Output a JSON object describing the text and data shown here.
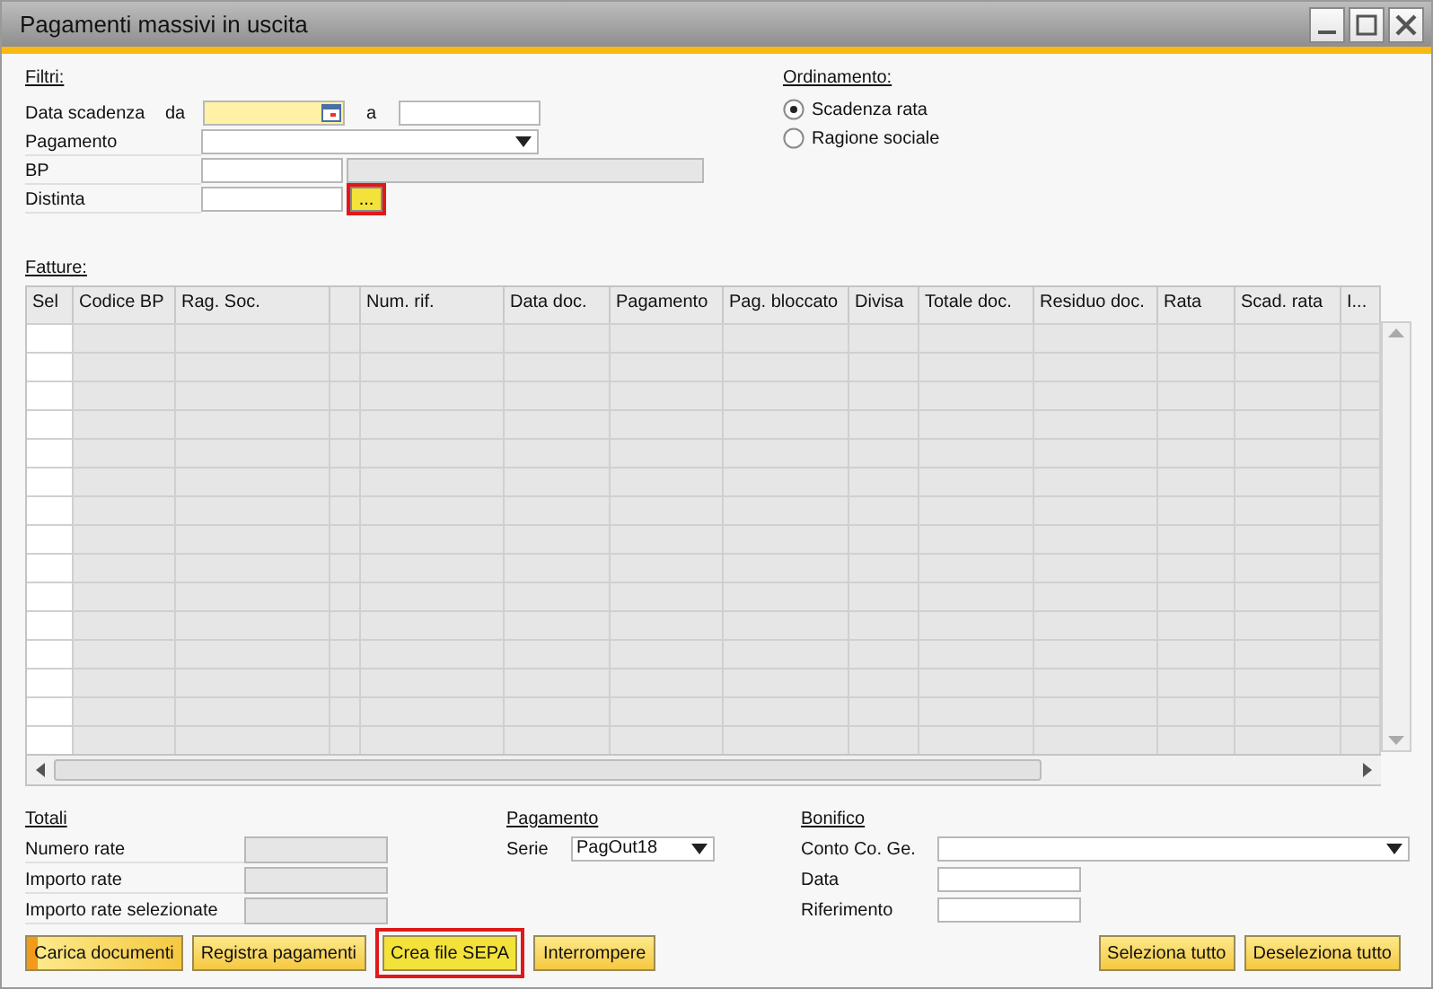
{
  "window": {
    "title": "Pagamenti massivi in uscita"
  },
  "filters": {
    "heading": "Filtri:",
    "due_date": {
      "label": "Data scadenza",
      "from_label": "da",
      "to_label": "a",
      "from_focused": true
    },
    "payment": {
      "label": "Pagamento"
    },
    "bp": {
      "label": "BP"
    },
    "batch": {
      "label": "Distinta",
      "browse_button": "...",
      "browse_highlighted": true
    }
  },
  "sorting": {
    "heading": "Ordinamento:",
    "options": [
      {
        "label": "Scadenza rata",
        "selected": true
      },
      {
        "label": "Ragione sociale",
        "selected": false
      }
    ]
  },
  "invoices": {
    "heading": "Fatture:",
    "columns": [
      {
        "label": "Sel",
        "kind": "check"
      },
      {
        "label": "Codice BP",
        "kind": "text"
      },
      {
        "label": "Rag. Soc.",
        "kind": "text"
      },
      {
        "kind": "blank"
      },
      {
        "label": "Num. rif.",
        "kind": "text"
      },
      {
        "label": "Data doc.",
        "kind": "text"
      },
      {
        "label": "Pagamento",
        "kind": "text"
      },
      {
        "label": "Pag. bloccato",
        "kind": "text"
      },
      {
        "label": "Divisa",
        "kind": "text"
      },
      {
        "label": "Totale doc.",
        "kind": "text"
      },
      {
        "label": "Residuo doc.",
        "kind": "text"
      },
      {
        "label": "Rata",
        "kind": "text"
      },
      {
        "label": "Scad. rata",
        "kind": "text"
      },
      {
        "label": "I...",
        "kind": "text"
      }
    ]
  },
  "totals": {
    "heading": "Totali",
    "fields": [
      {
        "label": "Numero rate"
      },
      {
        "label": "Importo rate"
      },
      {
        "label": "Importo rate selezionate"
      }
    ]
  },
  "payment": {
    "heading": "Pagamento",
    "series_label": "Serie",
    "series_value": "PagOut18"
  },
  "transfer": {
    "heading": "Bonifico",
    "fields": [
      {
        "label": "Conto Co. Ge.",
        "kind": "dropdown"
      },
      {
        "label": "Data",
        "kind": "text"
      },
      {
        "label": "Riferimento",
        "kind": "text"
      }
    ]
  },
  "buttons_left": [
    {
      "label": "Carica documenti",
      "highlighted": false,
      "focused": true
    },
    {
      "label": "Registra pagamenti",
      "highlighted": false,
      "focused": false
    },
    {
      "label": "Crea file SEPA",
      "highlighted": true,
      "focused": false
    },
    {
      "label": "Interrompere",
      "highlighted": false,
      "focused": false
    }
  ],
  "buttons_right": [
    {
      "label": "Seleziona tutto",
      "highlighted": false,
      "focused": false
    },
    {
      "label": "Deseleziona tutto",
      "highlighted": false,
      "focused": false
    }
  ]
}
